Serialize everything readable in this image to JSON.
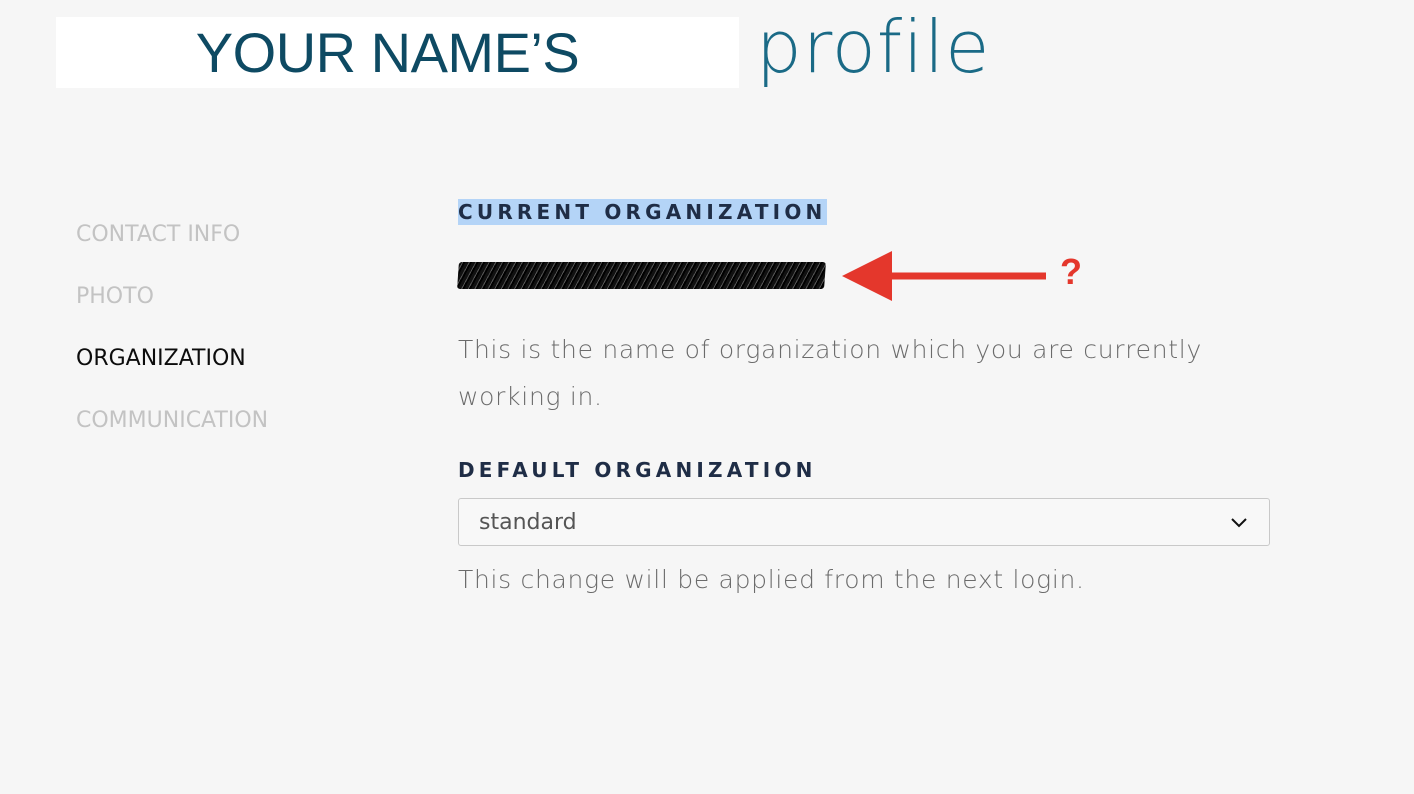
{
  "header": {
    "name_label": "YOUR NAME’S",
    "title": "profile"
  },
  "sidebar": {
    "items": [
      {
        "label": "CONTACT INFO",
        "active": false
      },
      {
        "label": "PHOTO",
        "active": false
      },
      {
        "label": "ORGANIZATION",
        "active": true
      },
      {
        "label": "COMMUNICATION",
        "active": false
      }
    ]
  },
  "main": {
    "current_org": {
      "heading": "CURRENT ORGANIZATION",
      "value": "",
      "description": "This is the name of organization which you are currently working in."
    },
    "annotation": {
      "mark": "?",
      "color": "#e4372c"
    },
    "default_org": {
      "heading": "DEFAULT ORGANIZATION",
      "selected": "standard",
      "help": "This change will be applied from the next login."
    }
  },
  "colors": {
    "background": "#f6f6f6",
    "brand": "#0e4a63",
    "heading": "#1f2d46",
    "selection_highlight": "#b4d4f7",
    "inactive_nav": "#c3c3c3"
  },
  "icons": {
    "select_chevron": "chevron-down-icon",
    "annotation_arrow": "arrow-left-icon"
  }
}
